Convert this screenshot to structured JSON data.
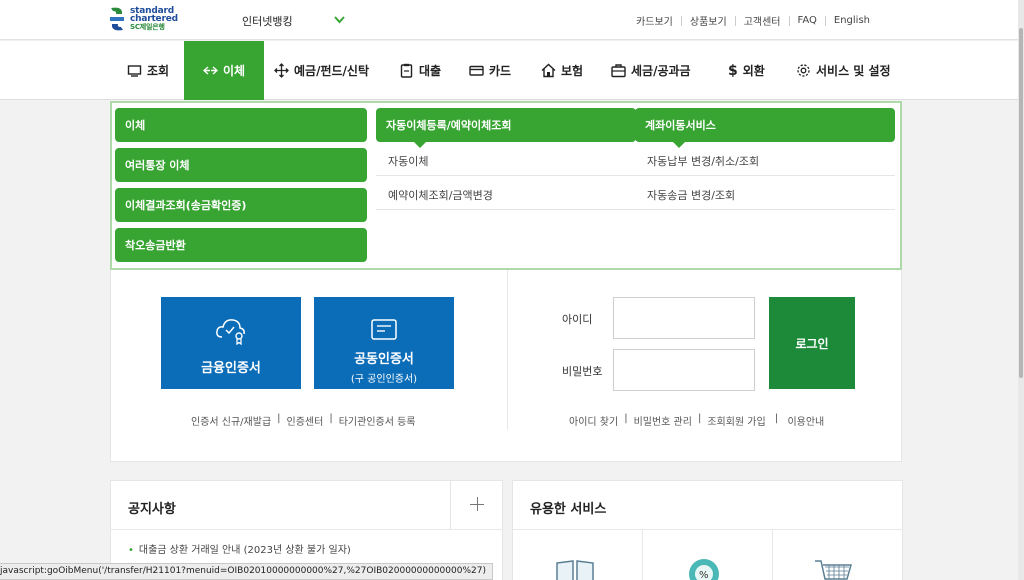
{
  "brand": {
    "line1": "standard",
    "line2": "chartered",
    "line3": "SC제일은행"
  },
  "topbar": {
    "internet_banking": "인터넷뱅킹",
    "util_links": [
      "카드보기",
      "상품보기",
      "고객센터",
      "FAQ",
      "English"
    ]
  },
  "gnb": {
    "items": [
      "조회",
      "이체",
      "예금/펀드/신탁",
      "대출",
      "카드",
      "보험",
      "세금/공과금",
      "외환",
      "서비스 및 설정"
    ],
    "active_index": 1
  },
  "mega": {
    "col1": [
      "이체",
      "여러통장 이체",
      "이체결과조회(송금확인증)",
      "착오송금반환"
    ],
    "col2": {
      "header": "자동이체등록/예약이체조회",
      "items": [
        "자동이체",
        "예약이체조회/금액변경"
      ]
    },
    "col3": {
      "header": "계좌이동서비스",
      "items": [
        "자동납부 변경/취소/조회",
        "자동송금 변경/조회"
      ]
    }
  },
  "login": {
    "cert_financial": "금융인증서",
    "cert_joint": "공동인증서",
    "cert_joint_sub": "(구 공인인증서)",
    "cert_links": [
      "인증서 신규/재발급",
      "인증센터",
      "타기관인증서 등록"
    ],
    "id_label": "아이디",
    "pw_label": "비밀번호",
    "login_button": "로그인",
    "account_links": [
      "아이디 찾기",
      "비밀번호 관리",
      "조회회원 가입",
      "이용안내"
    ]
  },
  "notice": {
    "title": "공지사항",
    "items": [
      "대출금 상환 거래일 안내 (2023년 상환 불가 일자)"
    ]
  },
  "services": {
    "title": "유용한 서비스"
  },
  "statusbar": {
    "url": "javascript:goOibMenu('/transfer/H21101?menuid=OIB02010000000000%27,%27OIB02000000000000%27)"
  },
  "colors": {
    "accent_green": "#38a533",
    "cert_blue": "#0b6cb8",
    "login_green": "#1d8a3a"
  }
}
